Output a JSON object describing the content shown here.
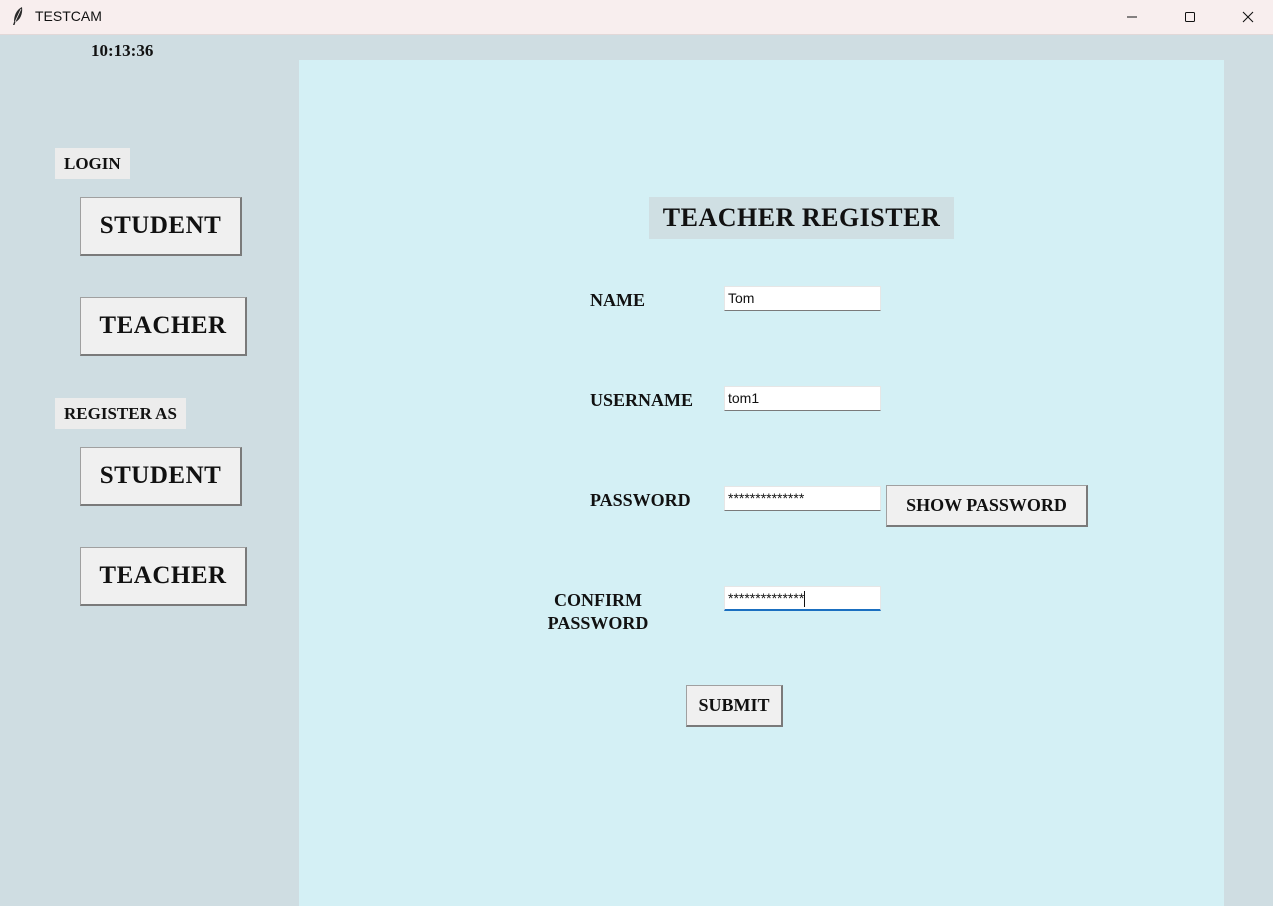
{
  "window": {
    "title": "TESTCAM",
    "icon": "feather-icon"
  },
  "sidebar": {
    "clock": "10:13:36",
    "login_label": "LOGIN",
    "login_student": "STUDENT",
    "login_teacher": "TEACHER",
    "register_label": "REGISTER AS",
    "register_student": "STUDENT",
    "register_teacher": "TEACHER"
  },
  "form": {
    "title": "TEACHER REGISTER",
    "name_label": "NAME",
    "name_value": "Tom",
    "username_label": "USERNAME",
    "username_value": "tom1",
    "password_label": "PASSWORD",
    "password_value": "**************",
    "show_password": "SHOW PASSWORD",
    "confirm_label_line1": "CONFIRM",
    "confirm_label_line2": "PASSWORD",
    "confirm_value": "**************",
    "submit": "SUBMIT"
  },
  "colors": {
    "window_bg": "#cfdde2",
    "panel_bg": "#d4f0f5",
    "titlebar_bg": "#f8eeee",
    "focus_accent": "#1a6fc0"
  }
}
